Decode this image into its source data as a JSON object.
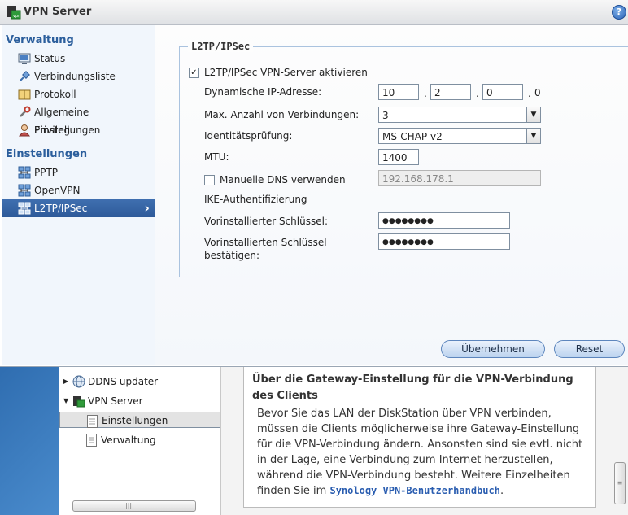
{
  "window": {
    "title": "VPN Server",
    "help_label": "?"
  },
  "sidebar": {
    "sections": [
      {
        "title": "Verwaltung",
        "items": [
          {
            "label": "Status",
            "icon": "monitor-icon"
          },
          {
            "label": "Verbindungsliste",
            "icon": "plug-icon"
          },
          {
            "label": "Protokoll",
            "icon": "book-icon"
          },
          {
            "label": "Allgemeine Einstellungen",
            "icon": "wrench-icon"
          },
          {
            "label": "Privileg",
            "icon": "user-icon"
          }
        ]
      },
      {
        "title": "Einstellungen",
        "items": [
          {
            "label": "PPTP",
            "icon": "network-icon"
          },
          {
            "label": "OpenVPN",
            "icon": "network-icon"
          },
          {
            "label": "L2TP/IPSec",
            "icon": "network-icon",
            "active": true
          }
        ]
      }
    ]
  },
  "form": {
    "legend": "L2TP/IPSec",
    "enable_label": "L2TP/IPSec VPN-Server aktivieren",
    "enable_checked": "✓",
    "dyn_ip_label": "Dynamische IP-Adresse:",
    "ip_octets": [
      "10",
      "2",
      "0",
      "0"
    ],
    "ip_dot": ".",
    "max_conn_label": "Max. Anzahl von Verbindungen:",
    "max_conn_value": "3",
    "auth_label": "Identitätsprüfung:",
    "auth_value": "MS-CHAP v2",
    "mtu_label": "MTU:",
    "mtu_value": "1400",
    "dns_label": "Manuelle DNS verwenden",
    "dns_value": "192.168.178.1",
    "ike_label": "IKE-Authentifizierung",
    "psk_label": "Vorinstallierter Schlüssel:",
    "psk_value": "●●●●●●●●",
    "psk_confirm_label_1": "Vorinstallierten Schlüssel",
    "psk_confirm_label_2": "bestätigen:",
    "psk_confirm_value": "●●●●●●●●"
  },
  "buttons": {
    "apply": "Übernehmen",
    "reset": "Reset"
  },
  "help_window": {
    "tree": [
      {
        "label": "DDNS updater",
        "expander": "▶"
      },
      {
        "label": "VPN Server",
        "expander": "▼"
      },
      {
        "label": "Einstellungen",
        "selected": true
      },
      {
        "label": "Verwaltung"
      }
    ],
    "title": "Über die Gateway-Einstellung für die VPN-Verbindung des Clients",
    "body": "Bevor Sie das LAN der DiskStation über VPN verbinden, müssen die Clients möglicherweise ihre Gateway-Einstellung für die VPN-Verbindung ändern. Ansonsten sind sie evtl. nicht in der Lage, eine Verbindung zum Internet herzustellen, während die VPN-Verbindung besteht. Weitere Einzelheiten finden Sie im",
    "link": "Synology VPN-Benutzerhandbuch",
    "link_suffix": ".",
    "scroll_grip": "|||",
    "vscroll_grip": "≡"
  }
}
